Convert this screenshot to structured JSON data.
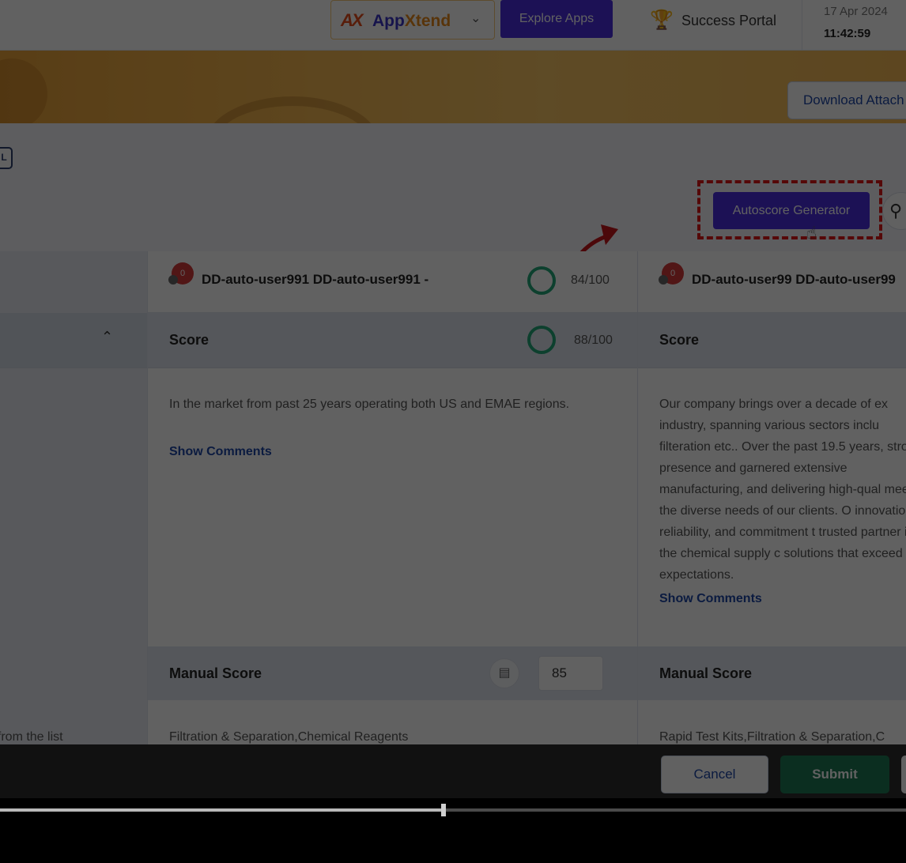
{
  "header": {
    "brand_mark": "AX",
    "brand_name_1": "App",
    "brand_name_2": "Xtend",
    "explore_label": "Explore Apps",
    "portal_label": "Success Portal",
    "date": "17 Apr 2024",
    "time": "11:42:59"
  },
  "banner": {
    "download_label": "Download Attach"
  },
  "toolbar": {
    "mini_icon_text": "L",
    "autoscore_label": "Autoscore Generator"
  },
  "vendors": [
    {
      "badge": "0",
      "name": "DD-auto-user991 DD-auto-user991 -",
      "total_score": "84/100",
      "score_label": "Score",
      "score_value": "88/100",
      "description": "In the market from past 25 years operating both US and EMAE regions.",
      "show_comments": "Show Comments",
      "manual_label": "Manual Score",
      "manual_value": "85",
      "categories": "Filtration & Separation,Chemical Reagents"
    },
    {
      "badge": "0",
      "name": "DD-auto-user99 DD-auto-user99",
      "score_label": "Score",
      "description": "Our company brings over a decade of ex industry, spanning various sectors inclu filteration etc.. Over the past 19.5 years, strong presence and garnered extensive manufacturing, and delivering high-qual meet the diverse needs of our clients. O innovation, reliability, and commitment t trusted partner in the chemical supply c solutions that exceed expectations.",
      "show_comments": "Show Comments",
      "manual_label": "Manual Score",
      "categories": "Rapid Test Kits,Filtration & Separation,C"
    }
  ],
  "left_panel": {
    "hint": "ct from the list"
  },
  "footer": {
    "cancel_label": "Cancel",
    "submit_label": "Submit"
  },
  "video": {
    "progress": 0.487
  },
  "colors": {
    "primary": "#4b2fe0",
    "submit": "#1f7a55",
    "highlight": "#e01616",
    "score_ring": "#22a87a"
  }
}
